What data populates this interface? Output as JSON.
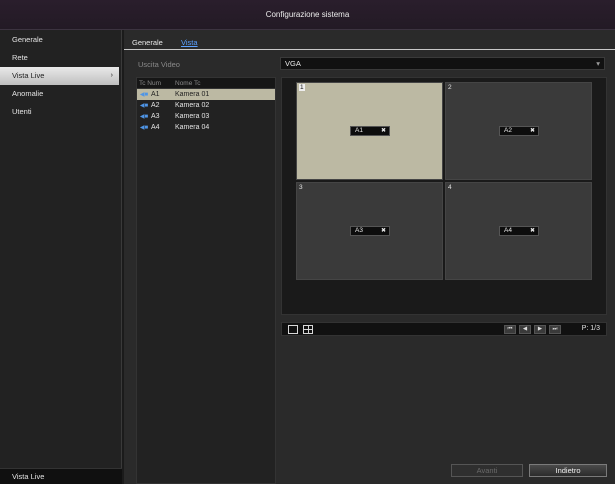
{
  "title": "Configurazione sistema",
  "sidebar": {
    "items": [
      {
        "label": "Generale",
        "active": false
      },
      {
        "label": "Rete",
        "active": false
      },
      {
        "label": "Vista Live",
        "active": true,
        "arrow": "›"
      },
      {
        "label": "Anomalie",
        "active": false
      },
      {
        "label": "Utenti",
        "active": false
      }
    ],
    "footer": "Vista Live"
  },
  "tabs": [
    {
      "label": "Generale",
      "active": false
    },
    {
      "label": "Vista",
      "active": true
    }
  ],
  "video_output": {
    "label": "Uscita Video",
    "value": "VGA",
    "caret": "▾"
  },
  "camera_list": {
    "headers": {
      "number": "Tc Num",
      "name": "Nome Tc"
    },
    "icon": "camera-icon",
    "rows": [
      {
        "num": "A1",
        "name": "Kamera 01",
        "selected": true
      },
      {
        "num": "A2",
        "name": "Kamera 02",
        "selected": false
      },
      {
        "num": "A3",
        "name": "Kamera 03",
        "selected": false
      },
      {
        "num": "A4",
        "name": "Kamera 04",
        "selected": false
      }
    ]
  },
  "layout_grid": {
    "cells": [
      {
        "index": "1",
        "camera": "A1",
        "selected": true
      },
      {
        "index": "2",
        "camera": "A2",
        "selected": false
      },
      {
        "index": "3",
        "camera": "A3",
        "selected": false
      },
      {
        "index": "4",
        "camera": "A4",
        "selected": false
      }
    ],
    "remove_glyph": "✖"
  },
  "pager": {
    "first": "⏮",
    "prev": "◀",
    "next": "▶",
    "last": "⏭",
    "page": "P: 1/3"
  },
  "buttons": {
    "apply": "Avanti",
    "back": "Indietro"
  },
  "colors": {
    "selected": "#bcb9a3",
    "accent_link": "#5aa0ff",
    "camera_icon": "#4f95e6"
  }
}
